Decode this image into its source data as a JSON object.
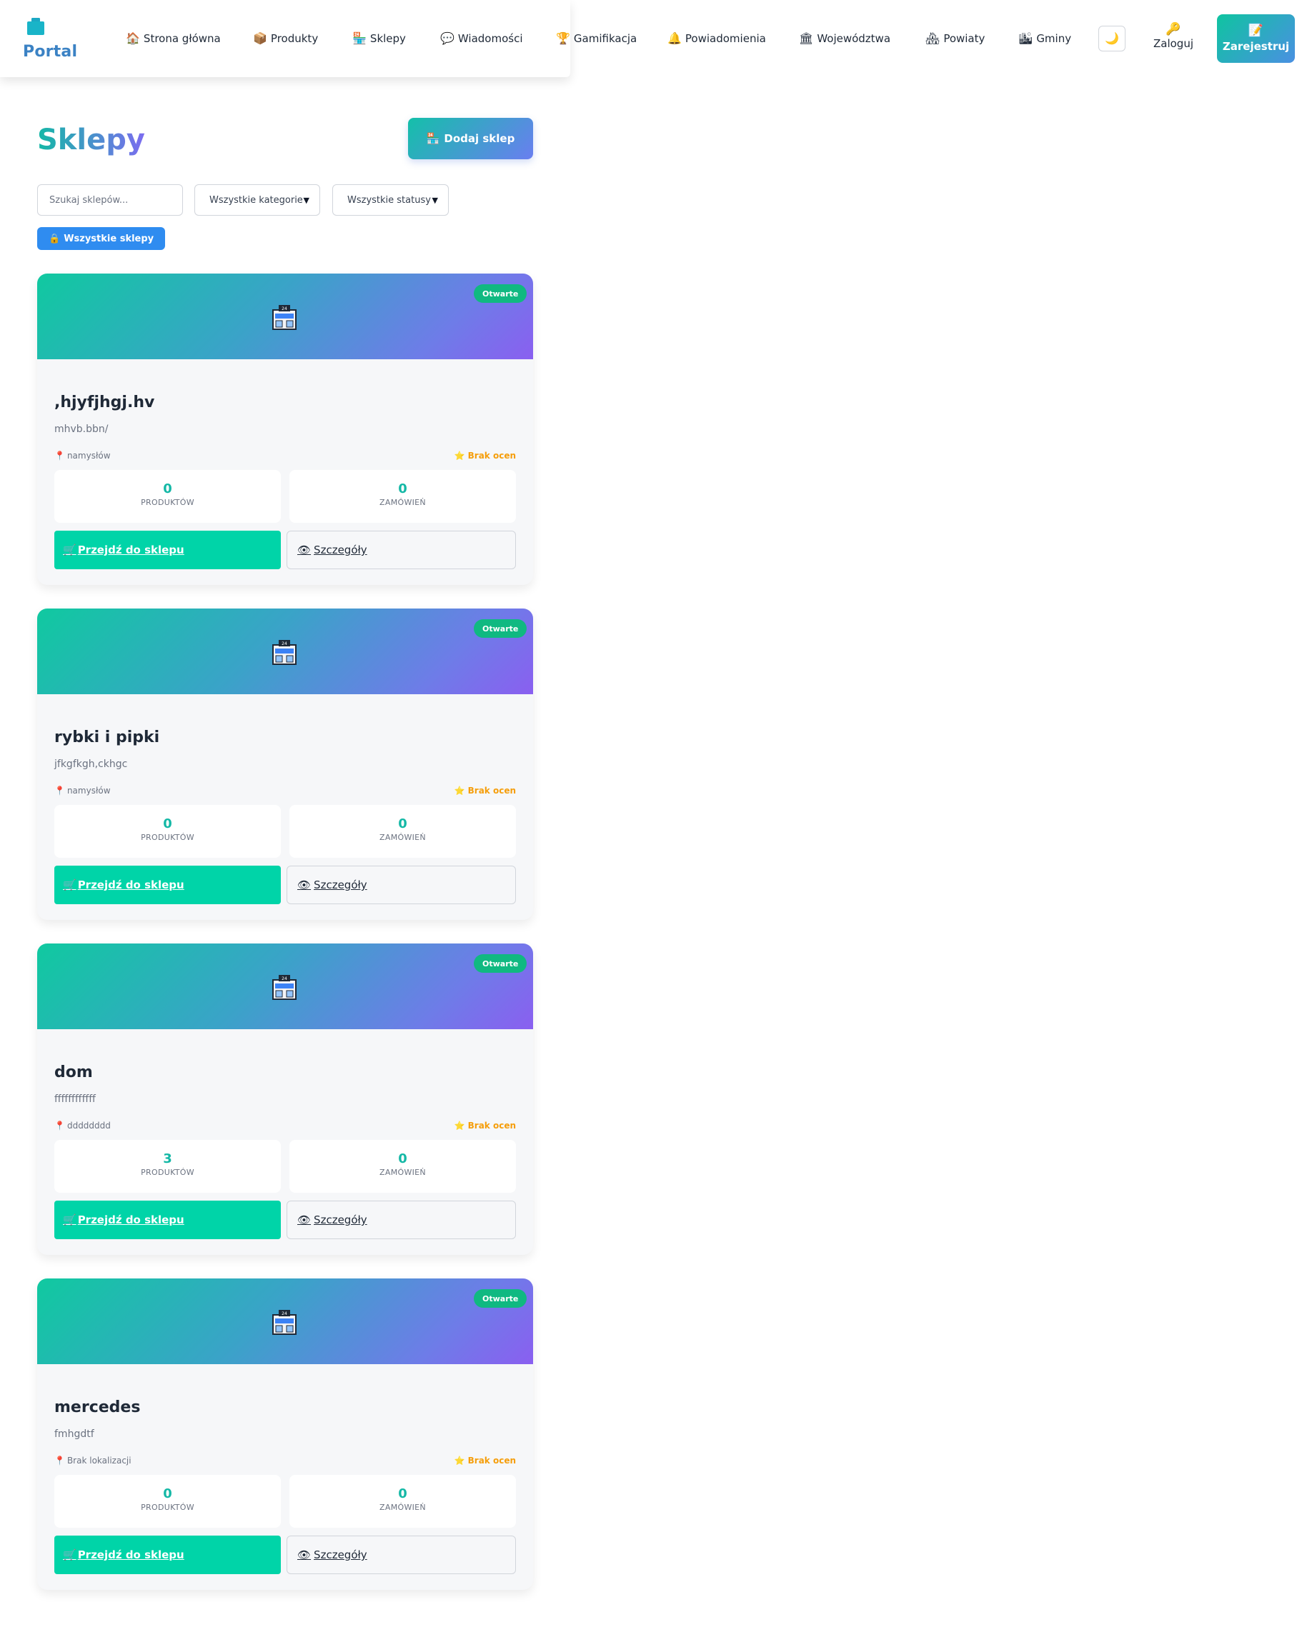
{
  "header": {
    "brand": "Portal",
    "nav": [
      {
        "label": "Strona główna",
        "icon": "home-icon"
      },
      {
        "label": "Produkty",
        "icon": "box-icon"
      },
      {
        "label": "Sklepy",
        "icon": "shop-icon"
      },
      {
        "label": "Wiadomości",
        "icon": "speech-bubble-icon"
      },
      {
        "label": "Gamifikacja",
        "icon": "trophy-icon"
      },
      {
        "label": "Powiadomienia",
        "icon": "bell-icon"
      },
      {
        "label": "Województwa",
        "icon": "government-building-icon"
      },
      {
        "label": "Powiaty",
        "icon": "houses-icon"
      },
      {
        "label": "Gminy",
        "icon": "city-icon"
      }
    ],
    "theme_toggle_icon": "moon-icon",
    "login_label": "Zaloguj",
    "register_label": "Zarejestruj"
  },
  "page": {
    "title": "Sklepy",
    "add_shop_label": "Dodaj sklep"
  },
  "filters": {
    "search_placeholder": "Szukaj sklepów...",
    "category_selected": "Wszystkie kategorie",
    "status_selected": "Wszystkie statusy",
    "chip_label": "Wszystkie sklepy"
  },
  "shops": [
    {
      "name": ",hjyfjhgj.hv",
      "description": "mhvb.bbn/",
      "location": "namysłów",
      "rating": "Brak ocen",
      "status": "Otwarte",
      "products_count": "0",
      "orders_count": "0"
    },
    {
      "name": "rybki i pipki",
      "description": "jfkgfkgh,ckhgc",
      "location": "namysłów",
      "rating": "Brak ocen",
      "status": "Otwarte",
      "products_count": "0",
      "orders_count": "0"
    },
    {
      "name": "dom",
      "description": "ffffffffffff",
      "location": "dddddddd",
      "rating": "Brak ocen",
      "status": "Otwarte",
      "products_count": "3",
      "orders_count": "0"
    },
    {
      "name": "mercedes",
      "description": "fmhgdtf",
      "location": "Brak lokalizacji",
      "rating": "Brak ocen",
      "status": "Otwarte",
      "products_count": "0",
      "orders_count": "0"
    }
  ],
  "labels": {
    "products": "PRODUKTÓW",
    "orders": "ZAMÓWIEŃ",
    "go_to_shop": "Przejdź do sklepu",
    "details": "Szczegóły"
  },
  "colors": {
    "accent": "#00d4a8",
    "status_open": "#10b981",
    "chip": "#2f8cf0",
    "rating": "#f59e0b"
  }
}
